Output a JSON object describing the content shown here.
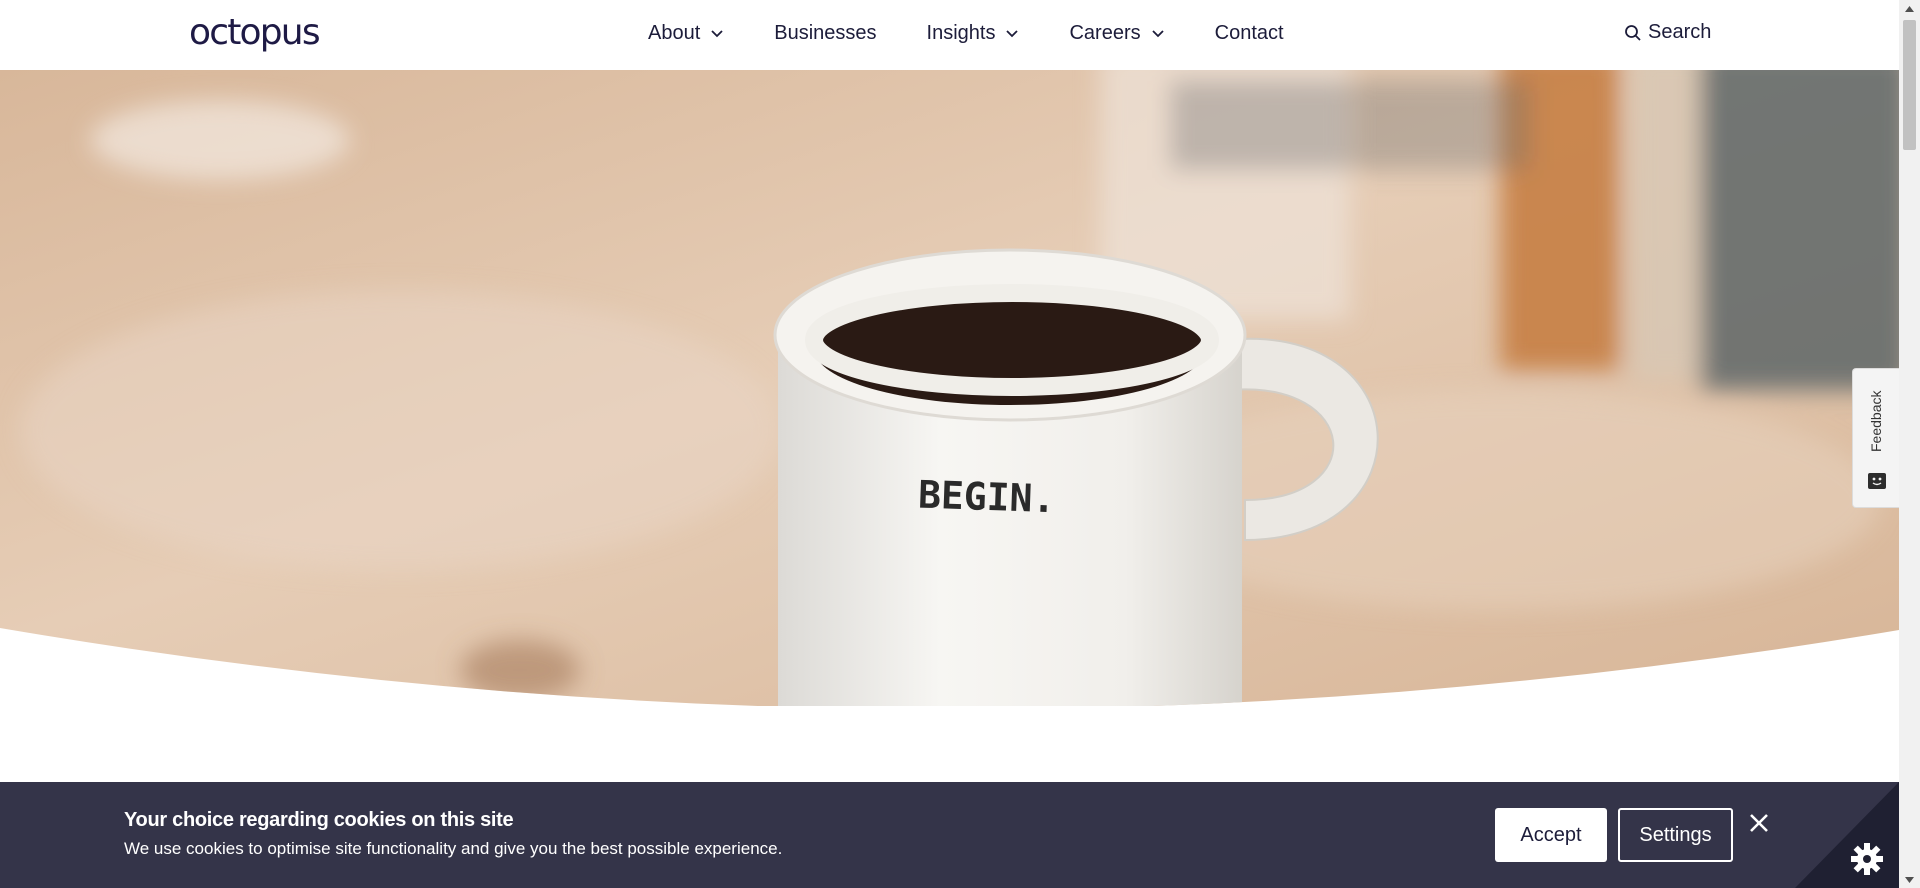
{
  "header": {
    "logo": "octopus",
    "nav": [
      {
        "label": "About",
        "has_dropdown": true
      },
      {
        "label": "Businesses",
        "has_dropdown": false
      },
      {
        "label": "Insights",
        "has_dropdown": true
      },
      {
        "label": "Careers",
        "has_dropdown": true
      },
      {
        "label": "Contact",
        "has_dropdown": false
      }
    ],
    "search_label": "Search"
  },
  "hero": {
    "mug_text": "BEGIN."
  },
  "feedback": {
    "label": "Feedback"
  },
  "cookie_banner": {
    "title": "Your choice regarding cookies on this site",
    "text": "We use cookies to optimise site functionality and give you the best possible experience.",
    "accept_label": "Accept",
    "settings_label": "Settings"
  },
  "colors": {
    "brand": "#1e1a45",
    "banner_bg": "#343449"
  }
}
